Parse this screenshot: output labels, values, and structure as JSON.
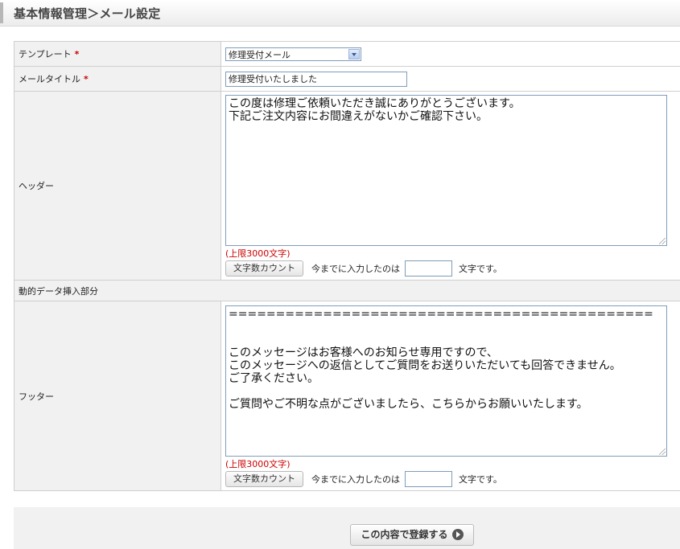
{
  "page": {
    "title": "基本情報管理＞メール設定"
  },
  "form": {
    "template": {
      "label": "テンプレート",
      "required_mark": "*",
      "selected": "修理受付メール"
    },
    "mail_title": {
      "label": "メールタイトル",
      "required_mark": "*",
      "value": "修理受付いたしました"
    },
    "header": {
      "label": "ヘッダー",
      "text": "この度は修理ご依頼いただき誠にありがとうございます。\n下記ご注文内容にお間違えがないかご確認下さい。",
      "limit_note": "(上限3000文字)",
      "count_button": "文字数カウント",
      "count_prefix": "今までに入力したのは",
      "count_value": "",
      "count_suffix": "文字です。"
    },
    "dynamic_section": {
      "label": "動的データ挿入部分"
    },
    "footer": {
      "label": "フッター",
      "text": "=============================================\n\n\nこのメッセージはお客様へのお知らせ専用ですので、\nこのメッセージへの返信としてご質問をお送りいただいても回答できません。\nご了承ください。\n\nご質問やご不明な点がございましたら、こちらからお願いいたします。",
      "limit_note": "(上限3000文字)",
      "count_button": "文字数カウント",
      "count_prefix": "今までに入力したのは",
      "count_value": "",
      "count_suffix": "文字です。"
    }
  },
  "actions": {
    "submit_label": "この内容で登録する"
  }
}
